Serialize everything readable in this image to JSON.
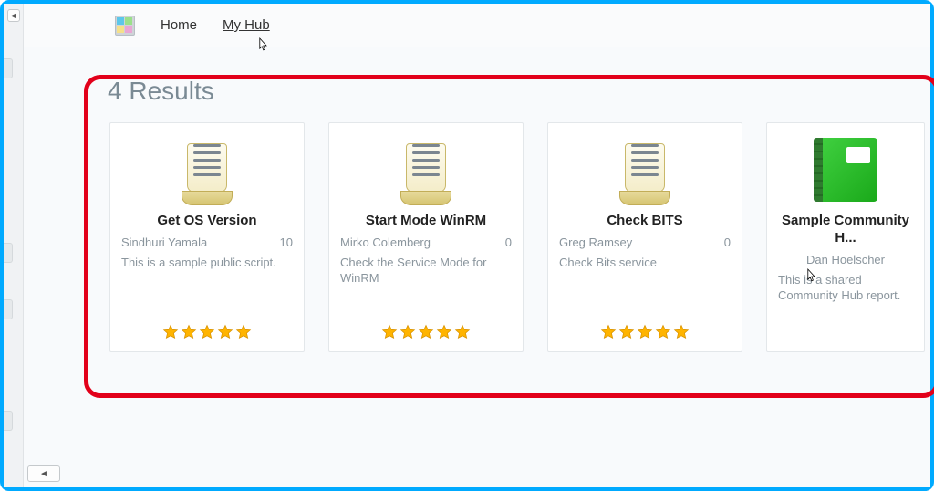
{
  "nav": {
    "home": "Home",
    "myhub": "My Hub"
  },
  "results": {
    "header": "4 Results",
    "cards": [
      {
        "title": "Get OS Version",
        "author": "Sindhuri Yamala",
        "count": "10",
        "desc": "This is a sample public script.",
        "icon": "script",
        "rating": 5
      },
      {
        "title": "Start Mode WinRM",
        "author": "Mirko Colemberg",
        "count": "0",
        "desc": "Check the Service Mode for WinRM",
        "icon": "script",
        "rating": 5
      },
      {
        "title": "Check BITS",
        "author": "Greg Ramsey",
        "count": "0",
        "desc": "Check Bits service",
        "icon": "script",
        "rating": 5
      },
      {
        "title": "Sample Community H...",
        "author": "Dan Hoelscher",
        "count": "",
        "desc": "This is a shared Community Hub report.",
        "icon": "report",
        "rating": 0
      }
    ]
  }
}
